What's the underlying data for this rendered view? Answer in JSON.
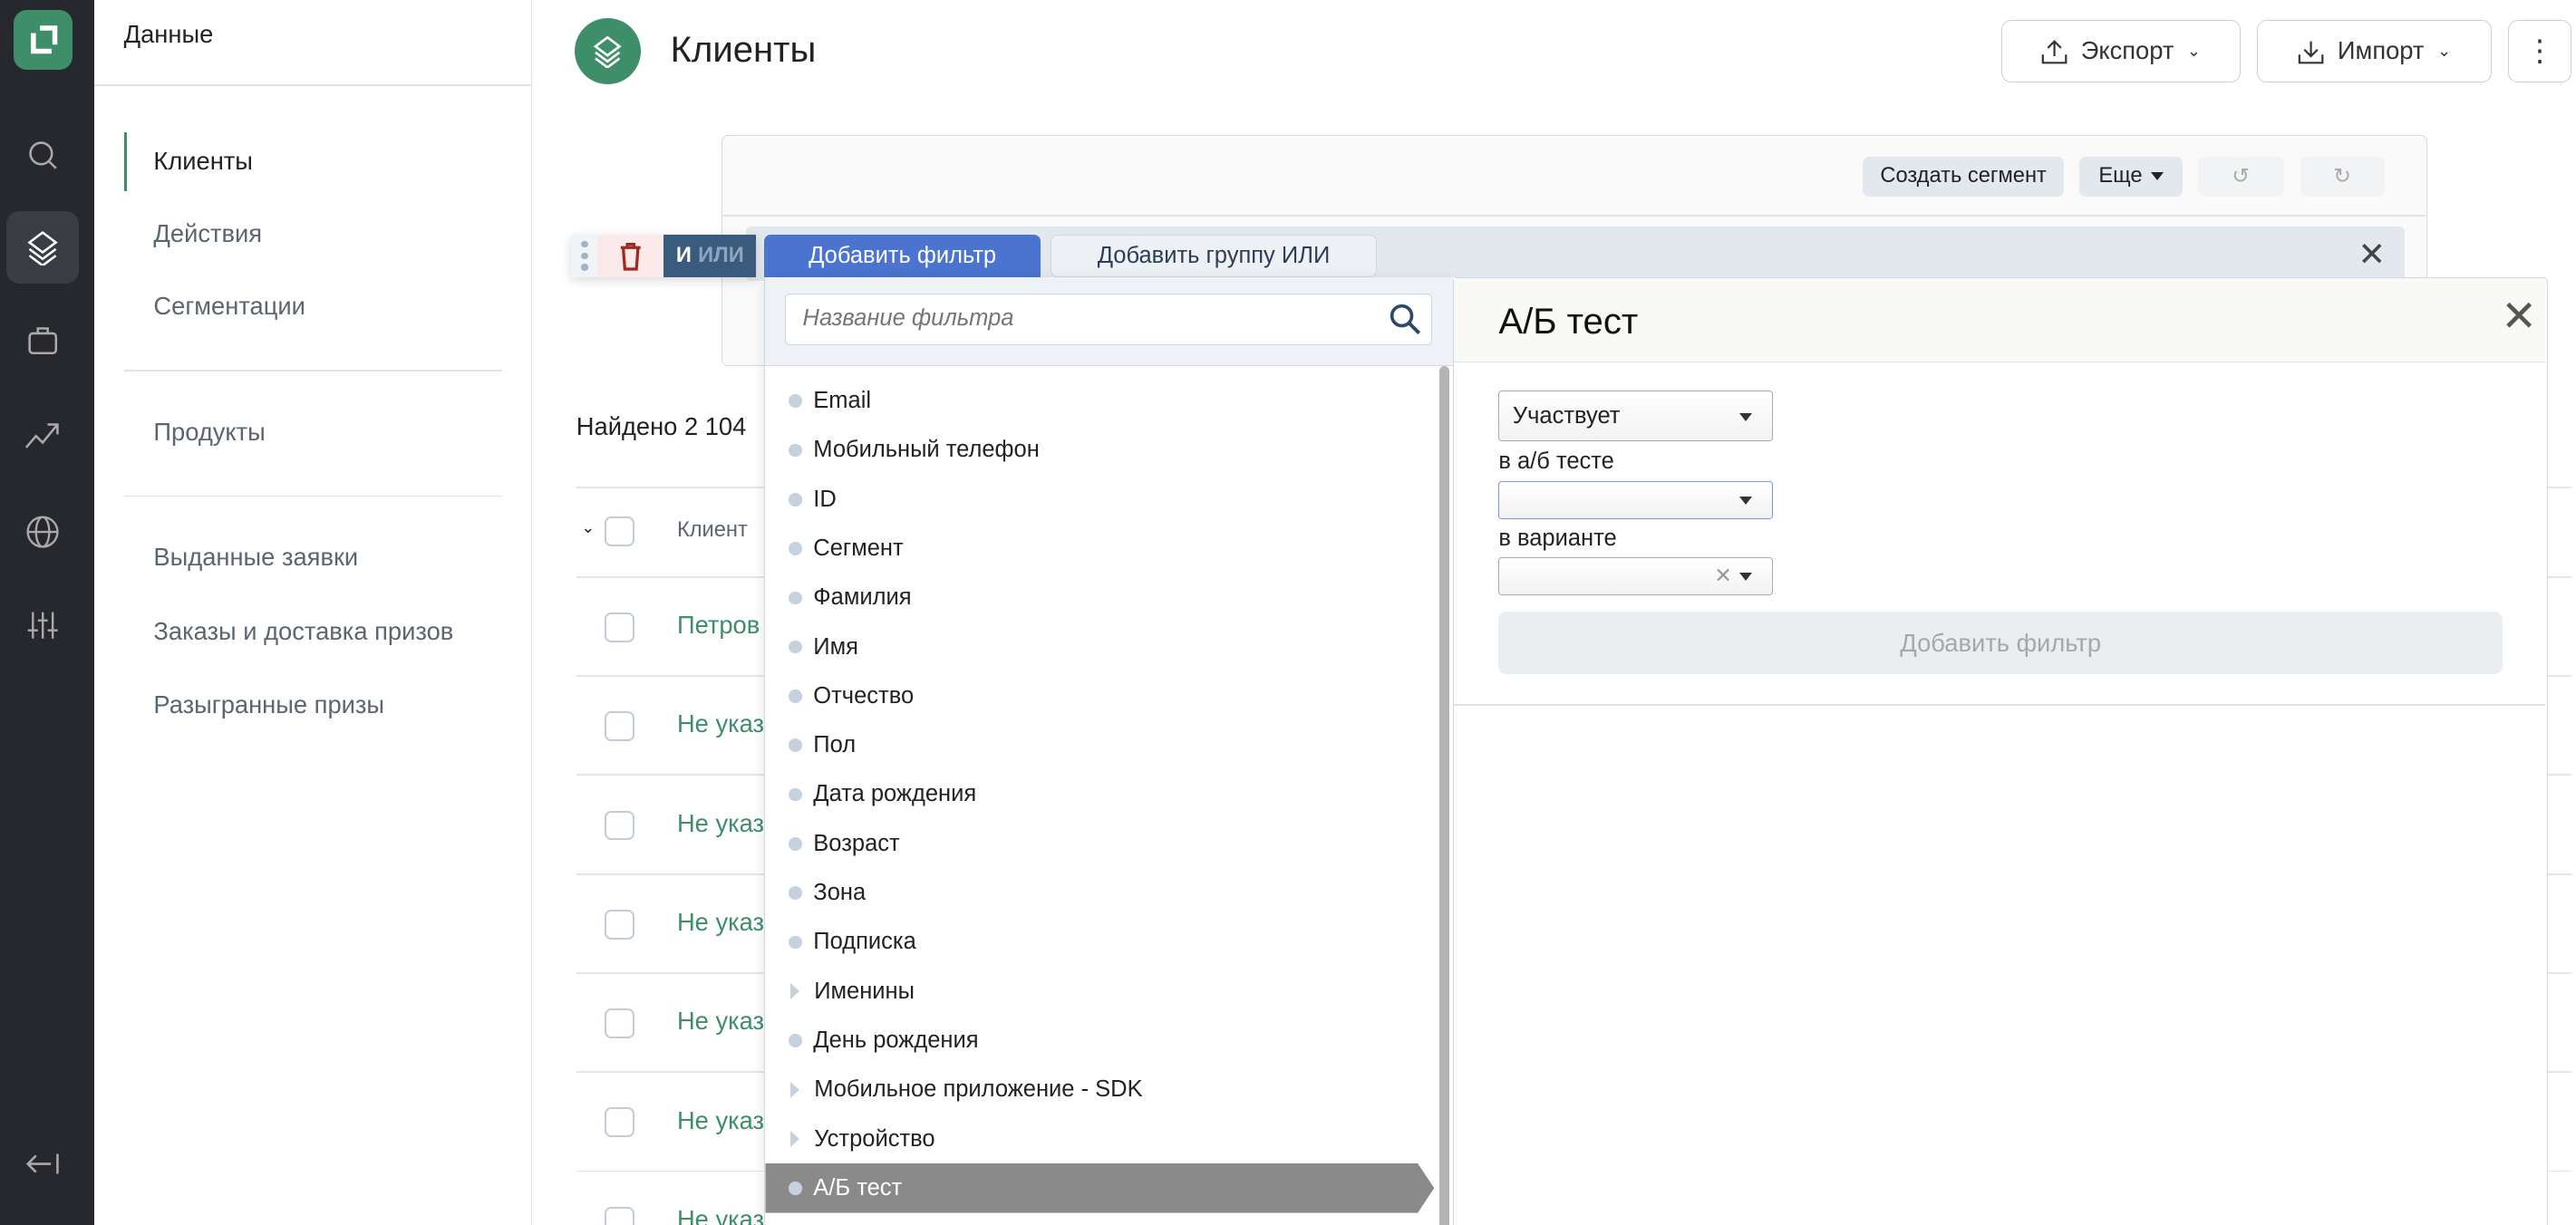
{
  "rail": {
    "icons": [
      "logo-icon",
      "search-icon",
      "layers-icon",
      "briefcase-icon",
      "trend-icon",
      "globe-icon",
      "sliders-icon",
      "collapse-icon"
    ]
  },
  "sidebar": {
    "header": "Данные",
    "items": [
      {
        "label": "Клиенты",
        "active": true
      },
      {
        "label": "Действия"
      },
      {
        "label": "Сегментации"
      },
      {
        "label": "Продукты"
      },
      {
        "label": "Выданные заявки"
      },
      {
        "label": "Заказы и доставка призов"
      },
      {
        "label": "Разыгранные призы"
      }
    ]
  },
  "header": {
    "title": "Клиенты",
    "export": "Экспорт",
    "import": "Импорт"
  },
  "filter_toolbar": {
    "create_segment": "Создать сегмент",
    "more": "Еще"
  },
  "group": {
    "and": "И",
    "or": "ИЛИ",
    "add_filter": "Добавить фильтр",
    "add_or_group": "Добавить группу ИЛИ"
  },
  "search": {
    "placeholder": "Название фильтра"
  },
  "filters": [
    {
      "label": "Email",
      "type": "leaf"
    },
    {
      "label": "Мобильный телефон",
      "type": "leaf"
    },
    {
      "label": "ID",
      "type": "leaf"
    },
    {
      "label": "Сегмент",
      "type": "leaf"
    },
    {
      "label": "Фамилия",
      "type": "leaf"
    },
    {
      "label": "Имя",
      "type": "leaf"
    },
    {
      "label": "Отчество",
      "type": "leaf"
    },
    {
      "label": "Пол",
      "type": "leaf"
    },
    {
      "label": "Дата рождения",
      "type": "leaf"
    },
    {
      "label": "Возраст",
      "type": "leaf"
    },
    {
      "label": "Зона",
      "type": "leaf"
    },
    {
      "label": "Подписка",
      "type": "leaf"
    },
    {
      "label": "Именины",
      "type": "group"
    },
    {
      "label": "День рождения",
      "type": "leaf"
    },
    {
      "label": "Мобильное приложение - SDK",
      "type": "group"
    },
    {
      "label": "Устройство",
      "type": "group"
    },
    {
      "label": "А/Б тест",
      "type": "leaf",
      "selected": true
    }
  ],
  "detail": {
    "title": "А/Б тест",
    "condition": "Участвует",
    "test_label": "в а/б тесте",
    "test_value": "",
    "variant_label": "в варианте",
    "variant_value": "",
    "submit": "Добавить фильтр"
  },
  "results": {
    "found": "Найдено 2 104",
    "column_client": "Клиент",
    "rows": [
      "Петров",
      "Не указ",
      "Не указ",
      "Не указ",
      "Не указ",
      "Не указ",
      "Не указ"
    ]
  },
  "colors": {
    "brand": "#3e8e6a",
    "primary": "#4a74d0",
    "rail": "#26282d",
    "logic": "#3a5a7e"
  }
}
